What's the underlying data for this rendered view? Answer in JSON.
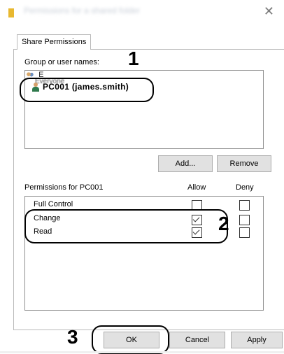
{
  "window": {
    "title": "Permissions for a shared folder",
    "close_glyph": "✕"
  },
  "tabs": [
    {
      "label": "Share Permissions"
    }
  ],
  "group_section": {
    "label": "Group or user names:",
    "users": [
      {
        "label": "E",
        "sublabel": "Everyone",
        "icon": "users-icon"
      },
      {
        "label": "PC001 (james.smith)",
        "icon": "user-icon"
      }
    ],
    "add_label": "Add...",
    "remove_label": "Remove"
  },
  "permissions": {
    "label": "Permissions for PC001",
    "allow_header": "Allow",
    "deny_header": "Deny",
    "rows": [
      {
        "name": "Full Control",
        "allow": false,
        "deny": false
      },
      {
        "name": "Change",
        "allow": true,
        "deny": false
      },
      {
        "name": "Read",
        "allow": true,
        "deny": false
      }
    ]
  },
  "footer": {
    "ok_label": "OK",
    "cancel_label": "Cancel",
    "apply_label": "Apply"
  },
  "callouts": {
    "one": "1",
    "two": "2",
    "three": "3"
  },
  "colors": {
    "folder_icon": "#e8b830",
    "button_bg": "#e1e1e1",
    "annotation": "#000000"
  }
}
